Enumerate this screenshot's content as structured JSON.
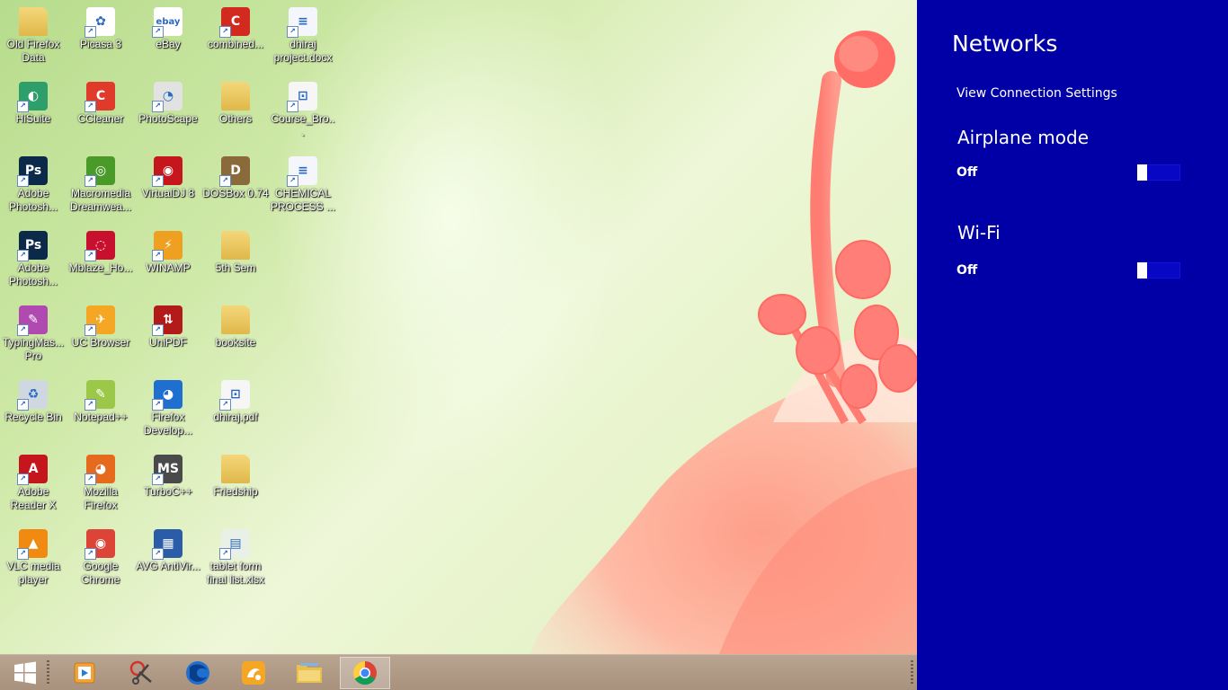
{
  "desktop_icons": [
    {
      "label": "Old Firefox Data",
      "icon": "folder-icon",
      "color": "#e8c860",
      "sym": "",
      "col": 0,
      "row": 0
    },
    {
      "label": "Picasa 3",
      "icon": "picasa-icon",
      "color": "#ffffff",
      "sym": "✿",
      "col": 1,
      "row": 0
    },
    {
      "label": "eBay",
      "icon": "ebay-icon",
      "color": "#ffffff",
      "sym": "ebay",
      "col": 2,
      "row": 0
    },
    {
      "label": "combined...",
      "icon": "pdf-combine-icon",
      "color": "#d22a1e",
      "sym": "C",
      "col": 3,
      "row": 0
    },
    {
      "label": "dhiraj project.docx",
      "icon": "document-icon",
      "color": "#f4f6fb",
      "sym": "≡",
      "col": 4,
      "row": 0
    },
    {
      "label": "HiSuite",
      "icon": "hisuite-icon",
      "color": "#2e9e6a",
      "sym": "◐",
      "col": 0,
      "row": 1
    },
    {
      "label": "CCleaner",
      "icon": "ccleaner-icon",
      "color": "#e03a2a",
      "sym": "C",
      "col": 1,
      "row": 1
    },
    {
      "label": "PhotoScape",
      "icon": "photoscape-icon",
      "color": "#e2e2e2",
      "sym": "◔",
      "col": 2,
      "row": 1
    },
    {
      "label": "Others",
      "icon": "folder-icon",
      "color": "#e8c860",
      "sym": "",
      "col": 3,
      "row": 1
    },
    {
      "label": "Course_Bro...",
      "icon": "pdf-icon",
      "color": "#f6f6f6",
      "sym": "⊡",
      "col": 4,
      "row": 1
    },
    {
      "label": "Adobe Photosh...",
      "icon": "photoshop-icon",
      "color": "#0b2a4a",
      "sym": "Ps",
      "col": 0,
      "row": 2
    },
    {
      "label": "Macromedia Dreamwea...",
      "icon": "dreamweaver-icon",
      "color": "#4a9a2a",
      "sym": "◎",
      "col": 1,
      "row": 2
    },
    {
      "label": "VirtualDJ 8",
      "icon": "virtualdj-icon",
      "color": "#c4161c",
      "sym": "◉",
      "col": 2,
      "row": 2
    },
    {
      "label": "DOSBox 0.74",
      "icon": "dosbox-icon",
      "color": "#8a6a3a",
      "sym": "D",
      "col": 3,
      "row": 2
    },
    {
      "label": "CHEMICAL PROCESS ...",
      "icon": "document-icon",
      "color": "#f4f6fb",
      "sym": "≡",
      "col": 4,
      "row": 2
    },
    {
      "label": "Adobe Photosh...",
      "icon": "photoshop-icon",
      "color": "#0b2a4a",
      "sym": "Ps",
      "col": 0,
      "row": 3
    },
    {
      "label": "Mblaze_Ho...",
      "icon": "mblaze-icon",
      "color": "#c8102e",
      "sym": "◌",
      "col": 1,
      "row": 3
    },
    {
      "label": "WINAMP",
      "icon": "winamp-icon",
      "color": "#f0a020",
      "sym": "⚡",
      "col": 2,
      "row": 3
    },
    {
      "label": "5th Sem",
      "icon": "folder-icon",
      "color": "#e8c860",
      "sym": "",
      "col": 3,
      "row": 3
    },
    {
      "label": "TypingMas... Pro",
      "icon": "typingmaster-icon",
      "color": "#b04ab0",
      "sym": "✎",
      "col": 0,
      "row": 4
    },
    {
      "label": "UC Browser",
      "icon": "ucbrowser-icon",
      "color": "#f5a623",
      "sym": "✈",
      "col": 1,
      "row": 4
    },
    {
      "label": "UniPDF",
      "icon": "unipdf-icon",
      "color": "#b31b1b",
      "sym": "⇅",
      "col": 2,
      "row": 4
    },
    {
      "label": "booksite",
      "icon": "folder-icon",
      "color": "#e8c860",
      "sym": "",
      "col": 3,
      "row": 4
    },
    {
      "label": "Recycle Bin",
      "icon": "recycle-bin-icon",
      "color": "#cfd8e0",
      "sym": "♻",
      "col": 0,
      "row": 5
    },
    {
      "label": "Notepad++",
      "icon": "notepad-plus-icon",
      "color": "#9bc848",
      "sym": "✎",
      "col": 1,
      "row": 5
    },
    {
      "label": "Firefox Develop...",
      "icon": "firefox-dev-icon",
      "color": "#1f6fd1",
      "sym": "◕",
      "col": 2,
      "row": 5
    },
    {
      "label": "dhiraj.pdf",
      "icon": "pdf-icon",
      "color": "#f6f6f6",
      "sym": "⊡",
      "col": 3,
      "row": 5
    },
    {
      "label": "Adobe Reader X",
      "icon": "adobe-reader-icon",
      "color": "#c4161c",
      "sym": "A",
      "col": 0,
      "row": 6
    },
    {
      "label": "Mozilla Firefox",
      "icon": "firefox-icon",
      "color": "#e66a1e",
      "sym": "◕",
      "col": 1,
      "row": 6
    },
    {
      "label": "TurboC++",
      "icon": "turboc-icon",
      "color": "#4a4a4a",
      "sym": "MS",
      "col": 2,
      "row": 6
    },
    {
      "label": "Friedship",
      "icon": "folder-icon",
      "color": "#e8c860",
      "sym": "",
      "col": 3,
      "row": 6
    },
    {
      "label": "VLC media player",
      "icon": "vlc-icon",
      "color": "#f08a10",
      "sym": "▲",
      "col": 0,
      "row": 7
    },
    {
      "label": "Google Chrome",
      "icon": "chrome-icon",
      "color": "#db4437",
      "sym": "◉",
      "col": 1,
      "row": 7
    },
    {
      "label": "AVG AntiVir...",
      "icon": "avg-icon",
      "color": "#2a5ca8",
      "sym": "▦",
      "col": 2,
      "row": 7
    },
    {
      "label": "tablet form final list.xlsx",
      "icon": "spreadsheet-icon",
      "color": "#e8f0e8",
      "sym": "▤",
      "col": 3,
      "row": 7
    }
  ],
  "taskbar": {
    "items": [
      {
        "name": "start-button",
        "icon": "windows-logo-icon",
        "active": false
      },
      {
        "name": "taskbar-media-player",
        "icon": "media-player-icon",
        "active": false
      },
      {
        "name": "taskbar-snipping-tool",
        "icon": "scissors-icon",
        "active": false
      },
      {
        "name": "taskbar-firefox-dev",
        "icon": "firefox-dev-icon",
        "active": false
      },
      {
        "name": "taskbar-uc-browser",
        "icon": "ucbrowser-icon",
        "active": false
      },
      {
        "name": "taskbar-file-explorer",
        "icon": "folder-icon",
        "active": false
      },
      {
        "name": "taskbar-chrome",
        "icon": "chrome-icon",
        "active": true
      }
    ]
  },
  "networks_panel": {
    "title": "Networks",
    "view_settings_link": "View Connection Settings",
    "airplane_mode": {
      "label": "Airplane mode",
      "state": "Off"
    },
    "wifi": {
      "label": "Wi-Fi",
      "state": "Off"
    },
    "colors": {
      "background": "#0000a6",
      "toggle_track": "#0808c4"
    }
  }
}
